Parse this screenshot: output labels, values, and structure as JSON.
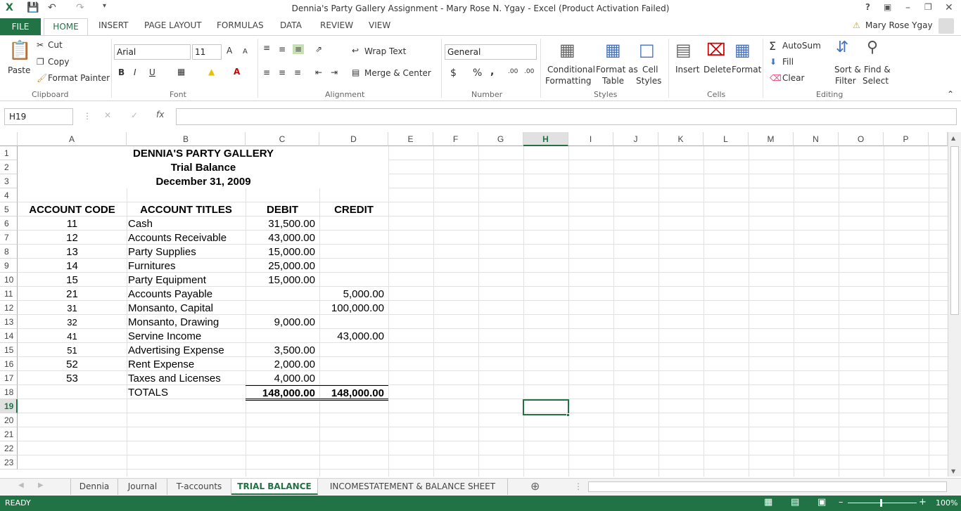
{
  "window": {
    "title": "Dennia's Party Gallery Assignment - Mary Rose N. Ygay - Excel (Product Activation Failed)",
    "help": "?",
    "user": "Mary Rose Ygay"
  },
  "tabs": [
    "FILE",
    "HOME",
    "INSERT",
    "PAGE LAYOUT",
    "FORMULAS",
    "DATA",
    "REVIEW",
    "VIEW"
  ],
  "ribbon": {
    "clipboard": {
      "paste": "Paste",
      "cut": "Cut",
      "copy": "Copy",
      "format_painter": "Format Painter",
      "label": "Clipboard"
    },
    "font": {
      "name": "Arial",
      "size": "11",
      "bold": "B",
      "italic": "I",
      "underline": "U",
      "grow": "A",
      "shrink": "A",
      "label": "Font"
    },
    "alignment": {
      "wrap": "Wrap Text",
      "merge": "Merge & Center",
      "label": "Alignment"
    },
    "number": {
      "format": "General",
      "currency": "$",
      "percent": "%",
      "comma": ",",
      "inc": ".00",
      "dec": ".00",
      "label": "Number"
    },
    "styles": {
      "conditional": "Conditional",
      "conditional2": "Formatting",
      "format_as": "Format as",
      "format_as2": "Table",
      "cell": "Cell",
      "cell2": "Styles",
      "label": "Styles"
    },
    "cells": {
      "insert": "Insert",
      "delete": "Delete",
      "format": "Format",
      "label": "Cells"
    },
    "editing": {
      "autosum": "AutoSum",
      "fill": "Fill",
      "clear": "Clear",
      "sort": "Sort &",
      "sort2": "Filter",
      "find": "Find &",
      "find2": "Select",
      "label": "Editing"
    }
  },
  "formula_bar": {
    "name_box": "H19",
    "fx": "fx",
    "value": ""
  },
  "columns": [
    "A",
    "B",
    "C",
    "D",
    "E",
    "F",
    "G",
    "H",
    "I",
    "J",
    "K",
    "L",
    "M",
    "N",
    "O",
    "P"
  ],
  "rows": [
    "1",
    "2",
    "3",
    "4",
    "5",
    "6",
    "7",
    "8",
    "9",
    "10",
    "11",
    "12",
    "13",
    "14",
    "15",
    "16",
    "17",
    "18",
    "19",
    "20",
    "21",
    "22",
    "23"
  ],
  "sheet": {
    "title1": "DENNIA'S PARTY GALLERY",
    "title2": "Trial Balance",
    "title3": "December 31, 2009",
    "headers": {
      "code": "ACCOUNT CODE",
      "titles": "ACCOUNT TITLES",
      "debit": "DEBIT",
      "credit": "CREDIT"
    },
    "entries": [
      {
        "code": "11",
        "title": "Cash",
        "debit": "31,500.00",
        "credit": ""
      },
      {
        "code": "12",
        "title": "Accounts Receivable",
        "debit": "43,000.00",
        "credit": ""
      },
      {
        "code": "13",
        "title": "Party Supplies",
        "debit": "15,000.00",
        "credit": ""
      },
      {
        "code": "14",
        "title": "Furnitures",
        "debit": "25,000.00",
        "credit": ""
      },
      {
        "code": "15",
        "title": "Party Equipment",
        "debit": "15,000.00",
        "credit": ""
      },
      {
        "code": "21",
        "title": "Accounts Payable",
        "debit": "",
        "credit": "5,000.00"
      },
      {
        "code": "31",
        "title": "Monsanto, Capital",
        "debit": "",
        "credit": "100,000.00"
      },
      {
        "code": "32",
        "title": "Monsanto, Drawing",
        "debit": "9,000.00",
        "credit": ""
      },
      {
        "code": "41",
        "title": "Servine Income",
        "debit": "",
        "credit": "43,000.00"
      },
      {
        "code": "51",
        "title": "Advertising Expense",
        "debit": "3,500.00",
        "credit": ""
      },
      {
        "code": "52",
        "title": "Rent Expense",
        "debit": "2,000.00",
        "credit": ""
      },
      {
        "code": "53",
        "title": "Taxes and Licenses",
        "debit": "4,000.00",
        "credit": ""
      }
    ],
    "totals": {
      "label": "TOTALS",
      "debit": "148,000.00",
      "credit": "148,000.00"
    }
  },
  "sheet_tabs": [
    "Dennia",
    "Journal",
    "T-accounts",
    "TRIAL BALANCE",
    "INCOMESTATEMENT & BALANCE SHEET"
  ],
  "active_sheet": "TRIAL BALANCE",
  "status": {
    "ready": "READY",
    "zoom": "100%"
  },
  "colors": {
    "accent": "#217346"
  }
}
